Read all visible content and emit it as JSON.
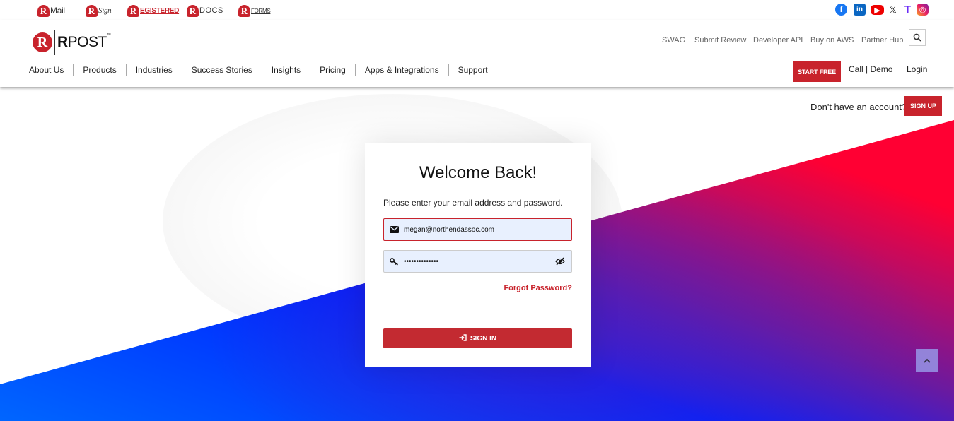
{
  "brands": [
    {
      "letter": "R",
      "name": "Mail"
    },
    {
      "letter": "R",
      "name": "Sign"
    },
    {
      "letter": "R",
      "name": "EGISTERED"
    },
    {
      "letter": "R",
      "name": "DOCS"
    },
    {
      "letter": "R",
      "name": "FORMS"
    }
  ],
  "social": {
    "facebook": "f",
    "linkedin": "in",
    "youtube": "▶",
    "x": "𝕏",
    "tiktok": "T",
    "instagram": "◎"
  },
  "logo": {
    "letter": "R",
    "text": "POST",
    "tm": "™"
  },
  "top_links": [
    "SWAG",
    "Submit Review",
    "Developer API",
    "Buy on AWS",
    "Partner Hub"
  ],
  "nav": [
    "About Us",
    "Products",
    "Industries",
    "Success Stories",
    "Insights",
    "Pricing",
    "Apps & Integrations",
    "Support"
  ],
  "header_actions": {
    "start_free": "START FREE",
    "call_demo": "Call | Demo",
    "login": "Login"
  },
  "account": {
    "prompt": "Don't have an account?",
    "signup": "SIGN UP"
  },
  "card": {
    "title": "Welcome Back!",
    "subtitle": "Please enter your email address and password.",
    "email_value": "megan@northendassoc.com",
    "password_value": "••••••••••••••",
    "forgot": "Forgot Password?",
    "signin": "SIGN IN"
  },
  "colors": {
    "brand_red": "#c8232c",
    "input_bg": "#e8f0fe"
  }
}
